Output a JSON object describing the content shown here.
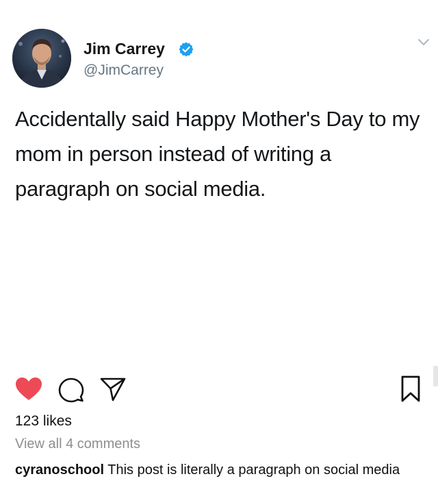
{
  "tweet": {
    "author_name": "Jim Carrey",
    "author_handle": "@JimCarrey",
    "text": "Accidentally said Happy Mother's Day to my mom in person instead of writing a paragraph on social media.",
    "verified_color": "#1da1f2"
  },
  "post": {
    "likes": "123 likes",
    "view_comments": "View all 4 comments",
    "caption_user": "cyranoschool",
    "caption_text": " This post is literally a paragraph on social media",
    "like_color": "#ed4956"
  },
  "icons": {
    "avatar": "avatar-photo",
    "verified": "verified-badge-icon",
    "menu": "chevron-down-icon",
    "like": "heart-icon",
    "comment": "comment-bubble-icon",
    "share": "paper-plane-icon",
    "save": "bookmark-icon"
  }
}
